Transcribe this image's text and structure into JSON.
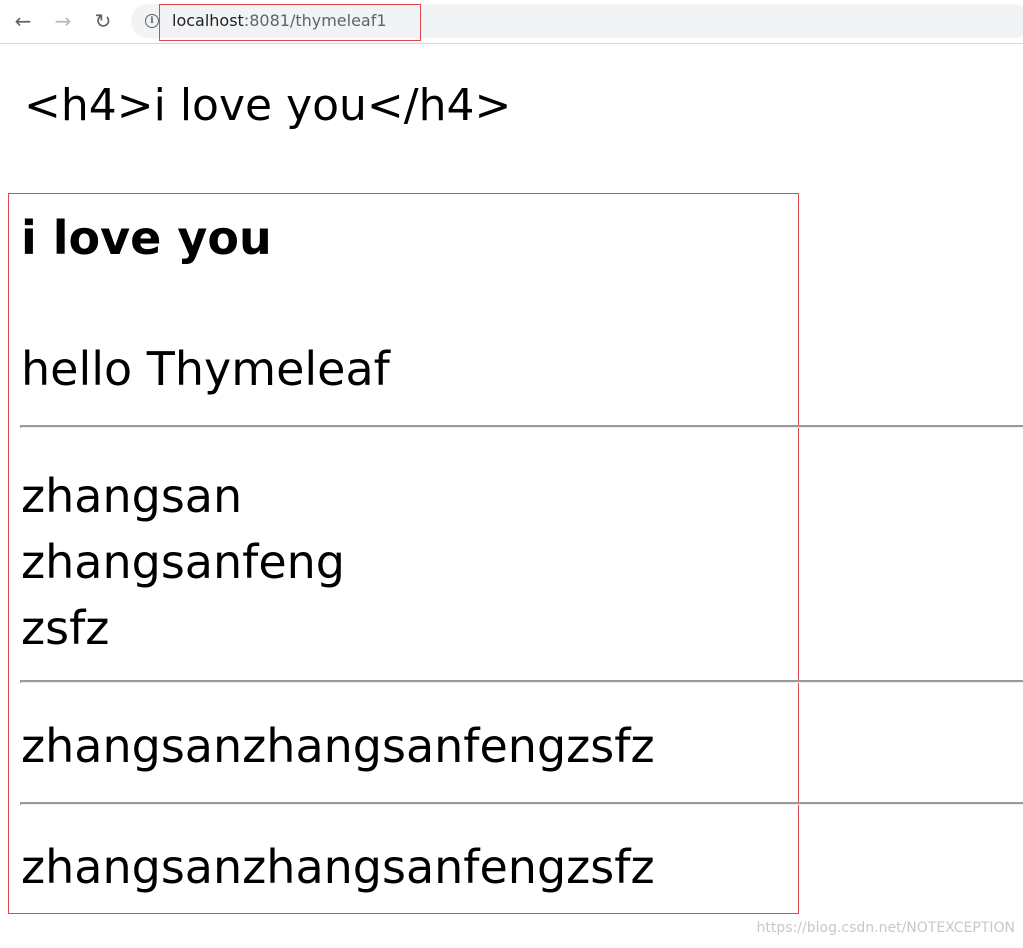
{
  "browser": {
    "back_icon": "←",
    "forward_icon": "→",
    "reload_icon": "↻",
    "info_icon": "i",
    "url_host": "localhost",
    "url_rest": ":8081/thymeleaf1"
  },
  "page": {
    "raw_h4_text": "<h4>i love you</h4>",
    "heading": "i love you",
    "hello": "hello Thymeleaf",
    "names": [
      "zhangsan",
      "zhangsanfeng",
      "zsfz"
    ],
    "joined_1": "zhangsanzhangsanfengzsfz",
    "joined_2": "zhangsanzhangsanfengzsfz"
  },
  "watermark": "https://blog.csdn.net/NOTEXCEPTION",
  "colors": {
    "annotation_red": "#e0484c",
    "hr_gray": "#9a9a9a"
  }
}
